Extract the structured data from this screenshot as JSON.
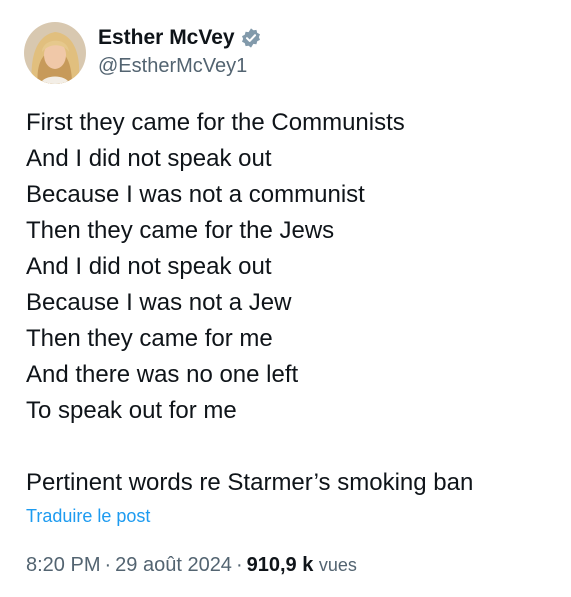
{
  "author": {
    "display_name": "Esther McVey",
    "handle": "@EstherMcVey1",
    "verified_color": "#829aab"
  },
  "post": {
    "lines": [
      "First they came for the Communists",
      "And I did not speak out",
      "Because I was not a communist",
      "Then they came for the Jews",
      "And I did not speak out",
      "Because I was not a Jew",
      "Then they came for me",
      "And there was no one left",
      "To speak out for me",
      "",
      "Pertinent words re Starmer’s smoking ban"
    ],
    "translate_label": "Traduire le post"
  },
  "meta": {
    "time": "8:20 PM",
    "separator": "·",
    "date": "29 août 2024",
    "views_count": "910,9 k",
    "views_label": "vues"
  },
  "colors": {
    "text": "#0f1419",
    "secondary": "#536471",
    "link": "#1d9bf0"
  }
}
